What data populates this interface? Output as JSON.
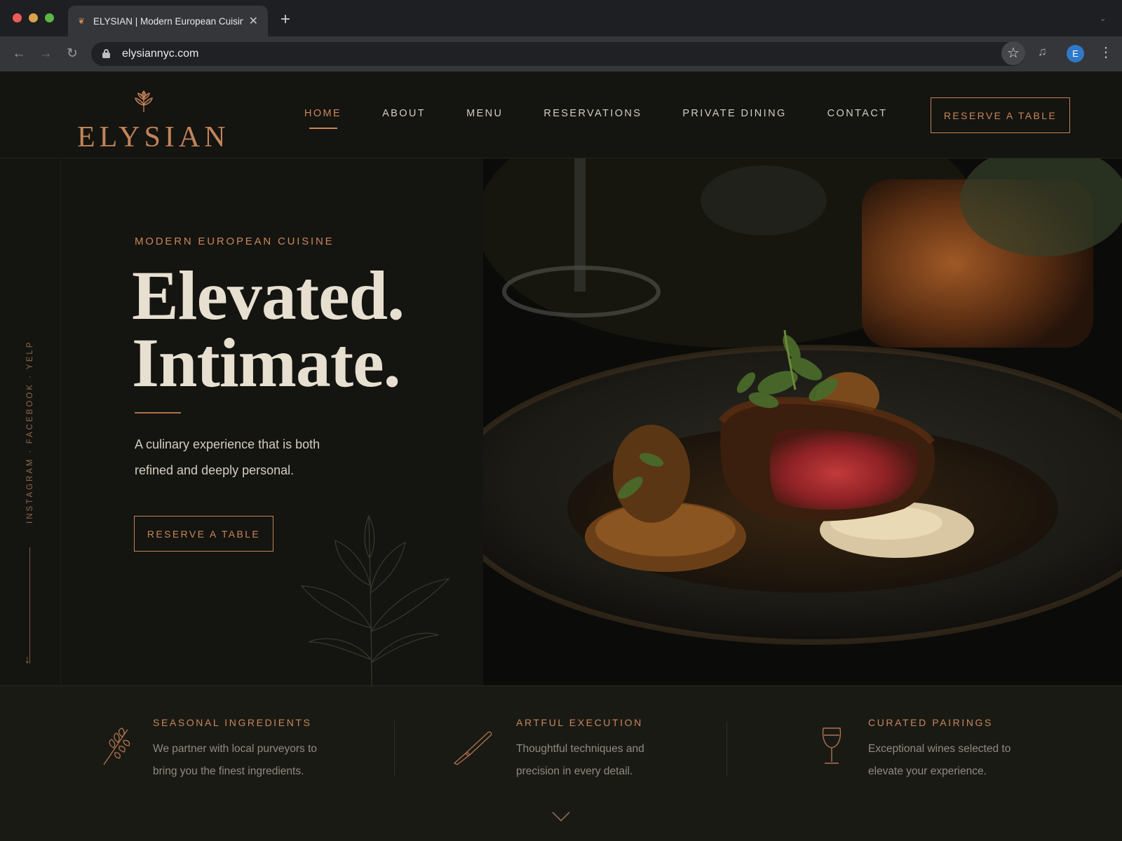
{
  "browser": {
    "tab_title": "ELYSIAN | Modern European Cuisine",
    "url": "elysiannyc.com",
    "profile_initial": "E"
  },
  "site": {
    "logo": "ELYSIAN",
    "nav": [
      "HOME",
      "ABOUT",
      "MENU",
      "RESERVATIONS",
      "PRIVATE DINING",
      "CONTACT"
    ],
    "active_nav": "HOME",
    "header_cta": "RESERVE A TABLE"
  },
  "hero": {
    "kicker": "MODERN EUROPEAN CUISINE",
    "headline_line1": "Elevated.",
    "headline_line2": "Intimate.",
    "lede": "A culinary experience that is both refined and deeply personal.",
    "cta": "RESERVE A TABLE",
    "social": [
      "INSTAGRAM",
      "FACEBOOK",
      "YELP"
    ]
  },
  "features": [
    {
      "icon": "herb-sprig-icon",
      "title": "SEASONAL INGREDIENTS",
      "desc": "We partner with local purveyors to bring you the finest ingredients."
    },
    {
      "icon": "knife-icon",
      "title": "ARTFUL EXECUTION",
      "desc": "Thoughtful techniques and precision in every detail."
    },
    {
      "icon": "wine-glass-icon",
      "title": "CURATED PAIRINGS",
      "desc": "Exceptional wines selected to elevate your experience."
    }
  ],
  "colors": {
    "background": "#141410",
    "accent_copper": "#c9875a",
    "heading_cream": "#e7dfd0"
  }
}
